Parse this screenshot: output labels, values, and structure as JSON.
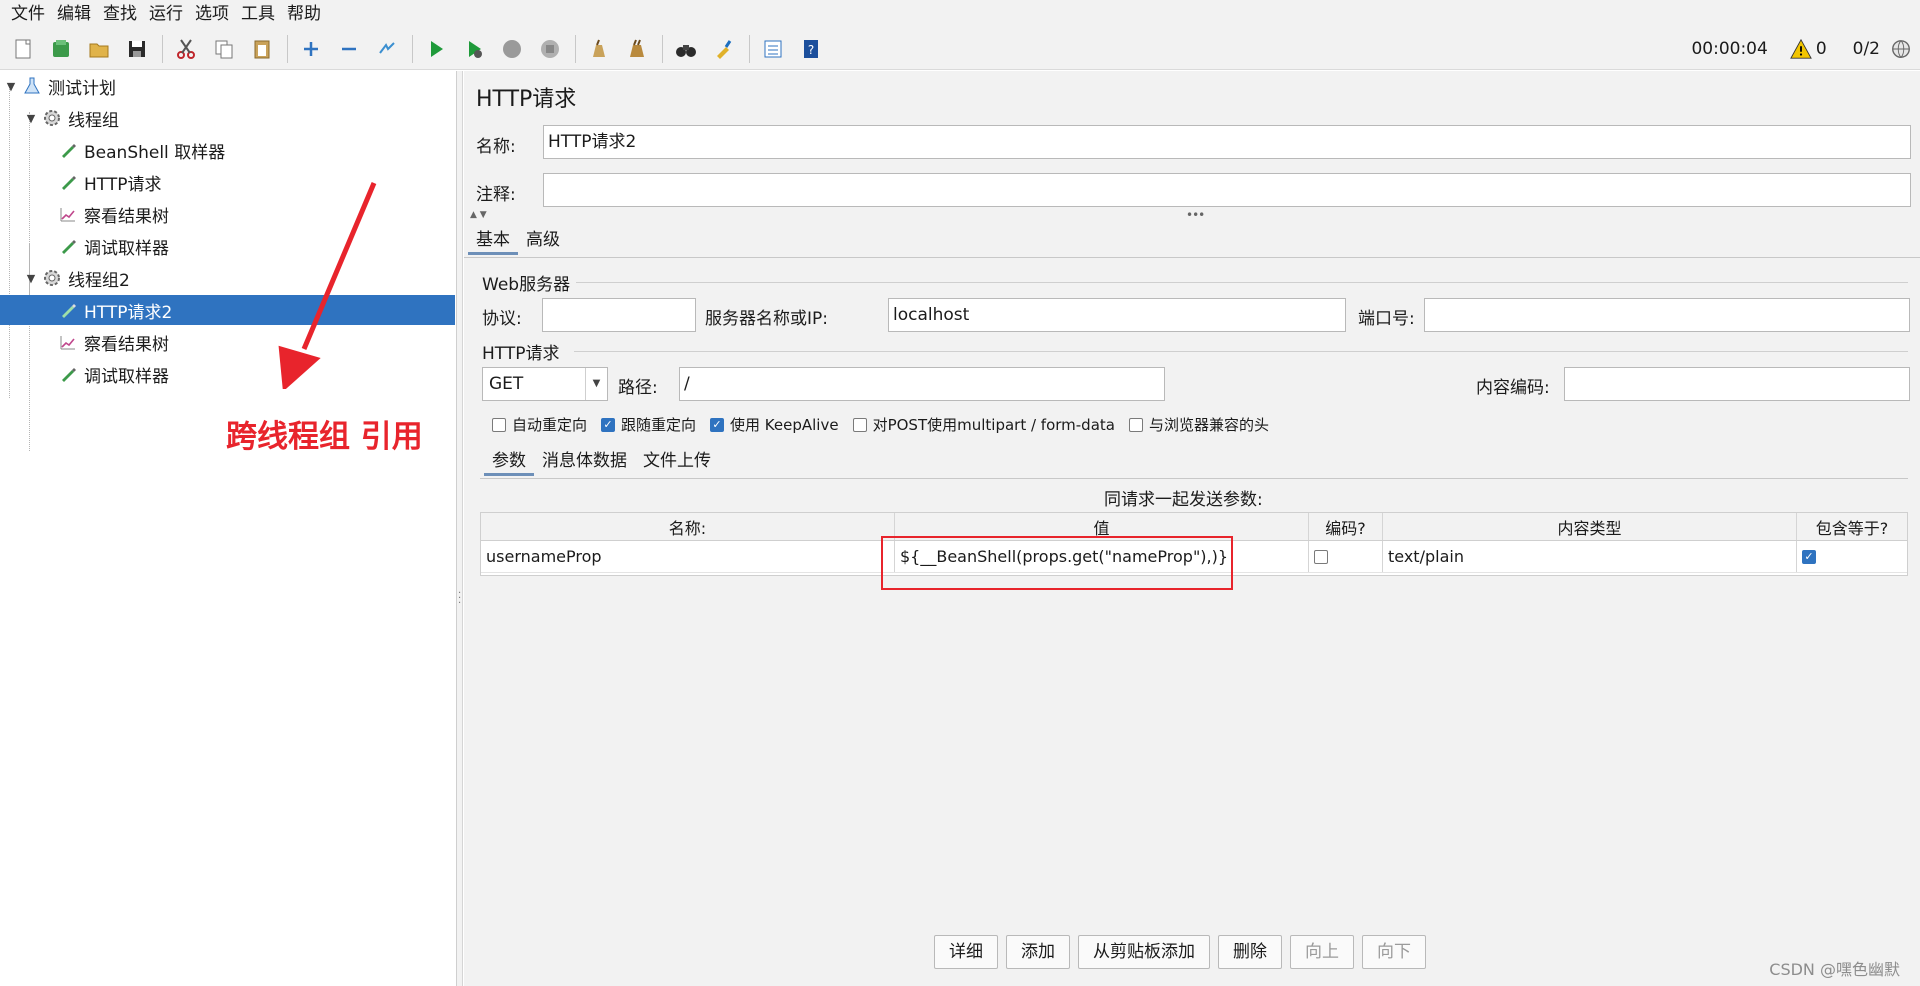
{
  "menu": [
    "文件",
    "编辑",
    "查找",
    "运行",
    "选项",
    "工具",
    "帮助"
  ],
  "toolbar": {
    "timer": "00:00:04",
    "warnings": "0",
    "threads": "0/2"
  },
  "tree": {
    "nodes": [
      {
        "label": "测试计划"
      },
      {
        "label": "线程组"
      },
      {
        "label": "BeanShell 取样器"
      },
      {
        "label": "HTTP请求"
      },
      {
        "label": "察看结果树"
      },
      {
        "label": "调试取样器"
      },
      {
        "label": "线程组2"
      },
      {
        "label": "HTTP请求2"
      },
      {
        "label": "察看结果树"
      },
      {
        "label": "调试取样器"
      }
    ],
    "annotation": "跨线程组 引用"
  },
  "colors": {
    "accent": "#2f73c0",
    "annotation": "#e8242c"
  },
  "panel": {
    "title": "HTTP请求",
    "name_label": "名称:",
    "name_value": "HTTP请求2",
    "comment_label": "注释:",
    "comment_value": "",
    "tabs": [
      "基本",
      "高级"
    ],
    "web_server": {
      "title": "Web服务器",
      "protocol_label": "协议:",
      "protocol_value": "",
      "server_label": "服务器名称或IP:",
      "server_value": "localhost",
      "port_label": "端口号:",
      "port_value": ""
    },
    "http_request": {
      "title": "HTTP请求",
      "method": "GET",
      "path_label": "路径:",
      "path_value": "/",
      "encoding_label": "内容编码:",
      "encoding_value": ""
    },
    "checkboxes": [
      {
        "label": "自动重定向",
        "checked": false
      },
      {
        "label": "跟随重定向",
        "checked": true
      },
      {
        "label": "使用 KeepAlive",
        "checked": true
      },
      {
        "label": "对POST使用multipart / form-data",
        "checked": false
      },
      {
        "label": "与浏览器兼容的头",
        "checked": false
      }
    ],
    "sub_tabs": [
      "参数",
      "消息体数据",
      "文件上传"
    ],
    "params_caption": "同请求一起发送参数:",
    "columns": [
      "名称:",
      "值",
      "编码?",
      "内容类型",
      "包含等于?"
    ],
    "rows": [
      {
        "name": "usernameProp",
        "value": "${__BeanShell(props.get(\"nameProp\"),)}",
        "encode": false,
        "content_type": "text/plain",
        "include_equals": true
      }
    ],
    "buttons": [
      {
        "label": "详细",
        "enabled": true
      },
      {
        "label": "添加",
        "enabled": true
      },
      {
        "label": "从剪贴板添加",
        "enabled": true
      },
      {
        "label": "删除",
        "enabled": true
      },
      {
        "label": "向上",
        "enabled": false
      },
      {
        "label": "向下",
        "enabled": false
      }
    ]
  },
  "watermark": "CSDN @嘿色幽默"
}
